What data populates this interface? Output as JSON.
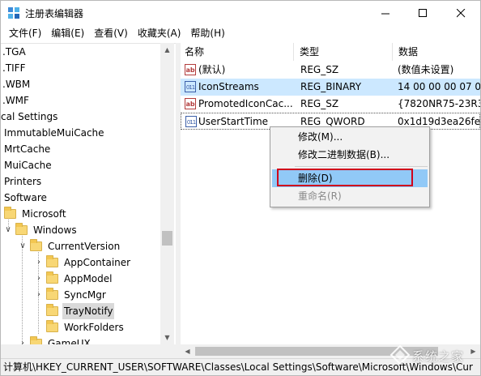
{
  "window": {
    "title": "注册表编辑器"
  },
  "menu": [
    "文件(F)",
    "编辑(E)",
    "查看(V)",
    "收藏夹(A)",
    "帮助(H)"
  ],
  "tree": [
    {
      "label": ".TGA"
    },
    {
      "label": ".TIFF"
    },
    {
      "label": ".WBM"
    },
    {
      "label": ".WMF"
    },
    {
      "label": "cal Settings"
    },
    {
      "label": "ImmutableMuiCache"
    },
    {
      "label": "MrtCache"
    },
    {
      "label": "MuiCache"
    },
    {
      "label": "Printers"
    },
    {
      "label": "Software"
    },
    {
      "label": "Microsoft"
    },
    {
      "label": "Windows"
    },
    {
      "label": "CurrentVersion"
    },
    {
      "label": "AppContainer"
    },
    {
      "label": "AppModel"
    },
    {
      "label": "SyncMgr"
    },
    {
      "label": "TrayNotify"
    },
    {
      "label": "WorkFolders"
    },
    {
      "label": "GameUX"
    }
  ],
  "values": {
    "columns": [
      "名称",
      "类型",
      "数据"
    ],
    "rows": [
      {
        "name": "(默认)",
        "type": "REG_SZ",
        "data": "(数值未设置)",
        "icon": "string-value-icon"
      },
      {
        "name": "IconStreams",
        "type": "REG_BINARY",
        "data": "14 00 00 00 07 00",
        "icon": "binary-value-icon"
      },
      {
        "name": "PromotedIconCac...",
        "type": "REG_SZ",
        "data": "{7820NR75-23R3",
        "icon": "string-value-icon"
      },
      {
        "name": "UserStartTime",
        "type": "REG_QWORD",
        "data": "0x1d19d3ea26fe",
        "icon": "binary-value-icon"
      }
    ]
  },
  "context_menu": {
    "items": [
      {
        "label": "修改(M)..."
      },
      {
        "label": "修改二进制数据(B)..."
      },
      {
        "label": "删除(D)"
      },
      {
        "label": "重命名(R)"
      }
    ]
  },
  "status": {
    "path": "计算机\\HKEY_CURRENT_USER\\SOFTWARE\\Classes\\Local Settings\\Software\\Microsoft\\Windows\\Cur"
  },
  "watermark": {
    "text": "系统之家"
  },
  "colors": {
    "selection": "#cce8ff",
    "menu_highlight": "#91c9f7",
    "annotation_red": "#d0021b",
    "folder": "#f8d775"
  }
}
